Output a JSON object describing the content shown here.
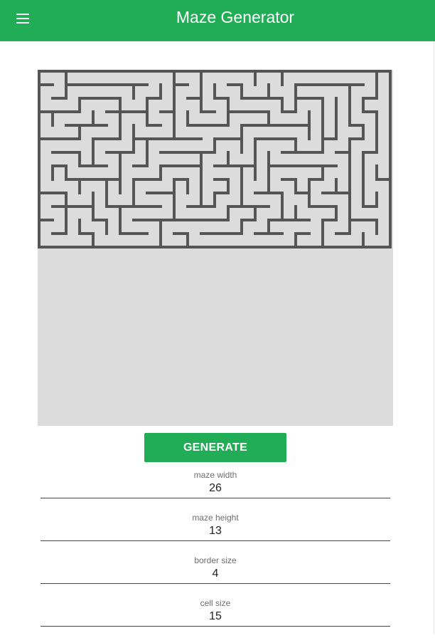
{
  "header": {
    "title": "Maze Generator",
    "menu_icon": "menu-icon"
  },
  "colors": {
    "app_bar": "#21ad55",
    "maze_background": "#dcdcdc",
    "maze_walls": "#555555"
  },
  "maze": {
    "columns": 26,
    "rows": 13
  },
  "actions": {
    "generate_label": "GENERATE"
  },
  "fields": [
    {
      "label": "maze width",
      "value": "26"
    },
    {
      "label": "maze height",
      "value": "13"
    },
    {
      "label": "border size",
      "value": "4"
    },
    {
      "label": "cell size",
      "value": "15"
    }
  ]
}
